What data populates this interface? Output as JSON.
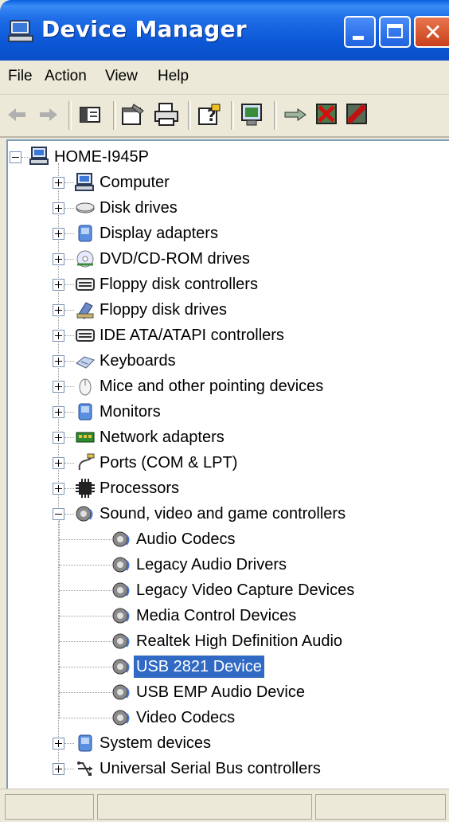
{
  "window": {
    "title": "Device Manager"
  },
  "menu": [
    "File",
    "Action",
    "View",
    "Help"
  ],
  "toolbar": {
    "buttons": [
      "back-icon",
      "forward-icon",
      "console-tree-icon",
      "properties-icon",
      "print-icon",
      "help-icon",
      "scan-hardware-icon",
      "update-driver-icon",
      "uninstall-icon",
      "disable-icon"
    ]
  },
  "tree": {
    "root": "HOME-I945P",
    "categories": [
      {
        "label": "Computer",
        "icon": "computer-icon"
      },
      {
        "label": "Disk drives",
        "icon": "disk-drive-icon"
      },
      {
        "label": "Display adapters",
        "icon": "display-adapter-icon"
      },
      {
        "label": "DVD/CD-ROM drives",
        "icon": "dvd-drive-icon"
      },
      {
        "label": "Floppy disk controllers",
        "icon": "controller-icon"
      },
      {
        "label": "Floppy disk drives",
        "icon": "floppy-drive-icon"
      },
      {
        "label": "IDE ATA/ATAPI controllers",
        "icon": "controller-icon"
      },
      {
        "label": "Keyboards",
        "icon": "keyboard-icon"
      },
      {
        "label": "Mice and other pointing devices",
        "icon": "mouse-icon"
      },
      {
        "label": "Monitors",
        "icon": "monitor-icon"
      },
      {
        "label": "Network adapters",
        "icon": "network-adapter-icon"
      },
      {
        "label": "Ports (COM & LPT)",
        "icon": "port-icon"
      },
      {
        "label": "Processors",
        "icon": "processor-icon"
      },
      {
        "label": "Sound, video and game controllers",
        "icon": "sound-icon",
        "expanded": true,
        "children": [
          "Audio Codecs",
          "Legacy Audio Drivers",
          "Legacy Video Capture Devices",
          "Media Control Devices",
          "Realtek High Definition Audio",
          "USB 2821 Device",
          "USB EMP Audio Device",
          "Video Codecs"
        ],
        "selected_child": "USB 2821 Device"
      },
      {
        "label": "System devices",
        "icon": "system-device-icon"
      },
      {
        "label": "Universal Serial Bus controllers",
        "icon": "usb-icon"
      }
    ]
  },
  "colors": {
    "selection": "#316ac5",
    "titlebar": "#0b57d6",
    "close": "#c9401b"
  }
}
